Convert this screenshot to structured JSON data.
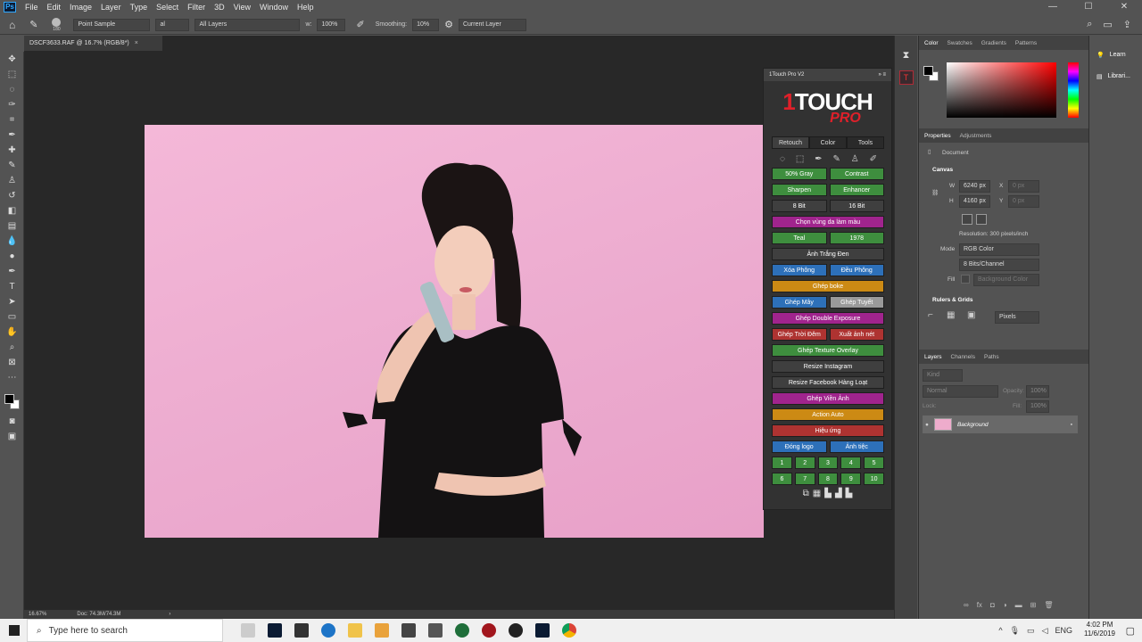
{
  "menubar": {
    "logo": "Ps",
    "items": [
      "File",
      "Edit",
      "Image",
      "Layer",
      "Type",
      "Select",
      "Filter",
      "3D",
      "View",
      "Window",
      "Help"
    ]
  },
  "window_controls": {
    "minimize": "—",
    "maximize": "☐",
    "close": "✕"
  },
  "options": {
    "brush_size": "180",
    "sample_mode": "Point Sample",
    "sample_suffix": "al",
    "layers_scope": "All Layers",
    "zoom_value": "100%",
    "smoothing_label": "Smoothing:",
    "smoothing_value": "10%",
    "sample_layer": "Current Layer"
  },
  "document": {
    "tab_title": "DSCF3633.RAF @ 16.7% (RGB/8*)",
    "zoom": "16.67%",
    "doc_size": "Doc: 74.3M/74.3M"
  },
  "plugin": {
    "title": "1Touch Pro V2",
    "logo_top": "TOUCH",
    "logo_num": "1",
    "logo_bottom": "PRO",
    "tabs": [
      "Retouch",
      "Color",
      "Tools"
    ],
    "rows": [
      [
        {
          "label": "50% Gray",
          "color": "g"
        },
        {
          "label": "Contrast",
          "color": "g"
        }
      ],
      [
        {
          "label": "Sharpen",
          "color": "g"
        },
        {
          "label": "Enhancer",
          "color": "g"
        }
      ],
      [
        {
          "label": "8 Bit",
          "color": "dk"
        },
        {
          "label": "16 Bit",
          "color": "dk"
        }
      ],
      [
        {
          "label": "Chọn vùng da làm màu",
          "color": "mg"
        }
      ],
      [
        {
          "label": "Teal",
          "color": "g"
        },
        {
          "label": "1978",
          "color": "g"
        }
      ],
      [
        {
          "label": "Ảnh Trắng Đen",
          "color": "dk"
        }
      ],
      [
        {
          "label": "Xóa Phông",
          "color": "bl"
        },
        {
          "label": "Đều Phông",
          "color": "bl"
        }
      ],
      [
        {
          "label": "Ghép boke",
          "color": "or"
        }
      ],
      [
        {
          "label": "Ghép Mây",
          "color": "bl"
        },
        {
          "label": "Ghép Tuyết",
          "color": "gy"
        }
      ],
      [
        {
          "label": "Ghép Double Exposure",
          "color": "mg"
        }
      ],
      [
        {
          "label": "Ghép Trời Đêm",
          "color": "rd"
        },
        {
          "label": "Xuất ảnh nét",
          "color": "rd"
        }
      ],
      [
        {
          "label": "Ghép Texture Overlay",
          "color": "g"
        }
      ],
      [
        {
          "label": "Resize Instagram",
          "color": "dk"
        }
      ],
      [
        {
          "label": "Resize Facebook Hàng Loạt",
          "color": "dk"
        }
      ],
      [
        {
          "label": "Ghép Viền Ảnh",
          "color": "mg"
        }
      ],
      [
        {
          "label": "Action Auto",
          "color": "or"
        }
      ],
      [
        {
          "label": "Hiệu ứng",
          "color": "rd"
        }
      ],
      [
        {
          "label": "Đóng logo",
          "color": "bl"
        },
        {
          "label": "Ảnh tiệc",
          "color": "bl"
        }
      ],
      [
        {
          "label": "1",
          "color": "g"
        },
        {
          "label": "2",
          "color": "g"
        },
        {
          "label": "3",
          "color": "g"
        },
        {
          "label": "4",
          "color": "g"
        },
        {
          "label": "5",
          "color": "g"
        }
      ],
      [
        {
          "label": "6",
          "color": "g"
        },
        {
          "label": "7",
          "color": "g"
        },
        {
          "label": "8",
          "color": "g"
        },
        {
          "label": "9",
          "color": "g"
        },
        {
          "label": "10",
          "color": "g"
        }
      ]
    ]
  },
  "color_panel": {
    "tabs": [
      "Color",
      "Swatches",
      "Gradients",
      "Patterns"
    ]
  },
  "properties": {
    "tabs": [
      "Properties",
      "Adjustments"
    ],
    "doc_label": "Document",
    "canvas_label": "Canvas",
    "w_label": "W",
    "w_value": "6240 px",
    "h_label": "H",
    "h_value": "4160 px",
    "x_label": "X",
    "x_value": "0 px",
    "y_label": "Y",
    "y_value": "0 px",
    "resolution": "Resolution: 300 pixels/inch",
    "mode_label": "Mode",
    "mode_value": "RGB Color",
    "bits_value": "8 Bits/Channel",
    "fill_label": "Fill",
    "fill_value": "Background Color",
    "rulers_label": "Rulers & Grids",
    "units_value": "Pixels"
  },
  "layers": {
    "tabs": [
      "Layers",
      "Channels",
      "Paths"
    ],
    "kind": "Kind",
    "blend": "Normal",
    "opacity_label": "Opacity:",
    "opacity_value": "100%",
    "lock_label": "Lock:",
    "fill_label": "Fill:",
    "fill_value": "100%",
    "layer_name": "Background"
  },
  "learn": {
    "learn": "Learn",
    "libraries": "Librari..."
  },
  "taskbar": {
    "search_placeholder": "Type here to search",
    "time": "4:02 PM",
    "date": "11/6/2019",
    "lang": "ENG"
  }
}
